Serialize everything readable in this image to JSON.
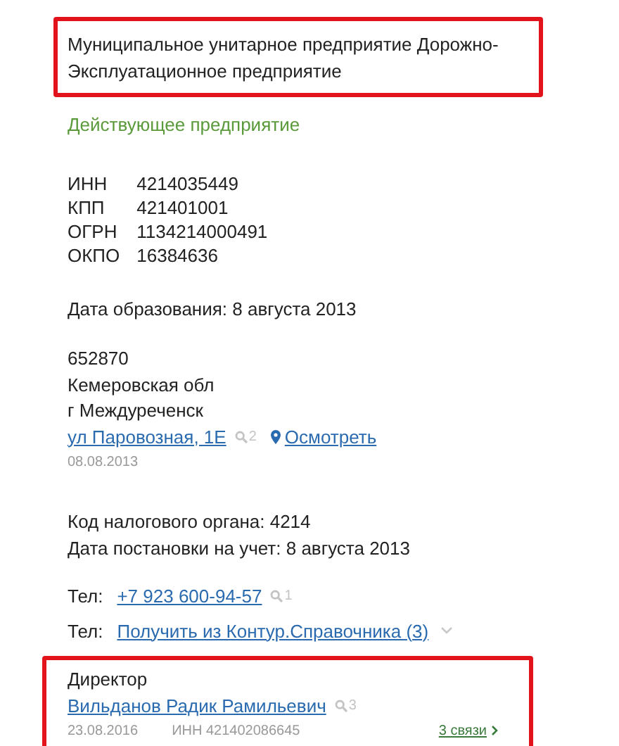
{
  "company": {
    "name": "Муниципальное унитарное предприятие Дорожно-Эксплуатационное предприятие",
    "highlighted": true
  },
  "status": "Действующее предприятие",
  "codes": [
    {
      "label": "ИНН",
      "value": "4214035449"
    },
    {
      "label": "КПП",
      "value": "421401001"
    },
    {
      "label": "ОГРН",
      "value": "1134214000491"
    },
    {
      "label": "ОКПО",
      "value": "16384636"
    }
  ],
  "founded": "Дата образования: 8 августа 2013",
  "address": {
    "lines": [
      "652870",
      "Кемеровская обл",
      "г Междуреченск"
    ],
    "street": "ул Паровозная, 1Е",
    "street_count": "2",
    "map_link": "Осмотреть",
    "date": "08.08.2013"
  },
  "tax": [
    "Код налогового органа: 4214",
    "Дата постановки на учет: 8 августа 2013"
  ],
  "phones": [
    {
      "label": "Тел:",
      "link": "+7 923 600-94-57",
      "count": "1",
      "kind": "number"
    },
    {
      "label": "Тел:",
      "link": "Получить из Контур.Справочника (3)",
      "kind": "dropdown"
    }
  ],
  "director": {
    "highlighted": true,
    "role": "Директор",
    "name": "Вильданов Радик Рамильевич",
    "count": "3",
    "date": "23.08.2016",
    "inn": "ИНН 421402086645",
    "links": "3 связи"
  }
}
